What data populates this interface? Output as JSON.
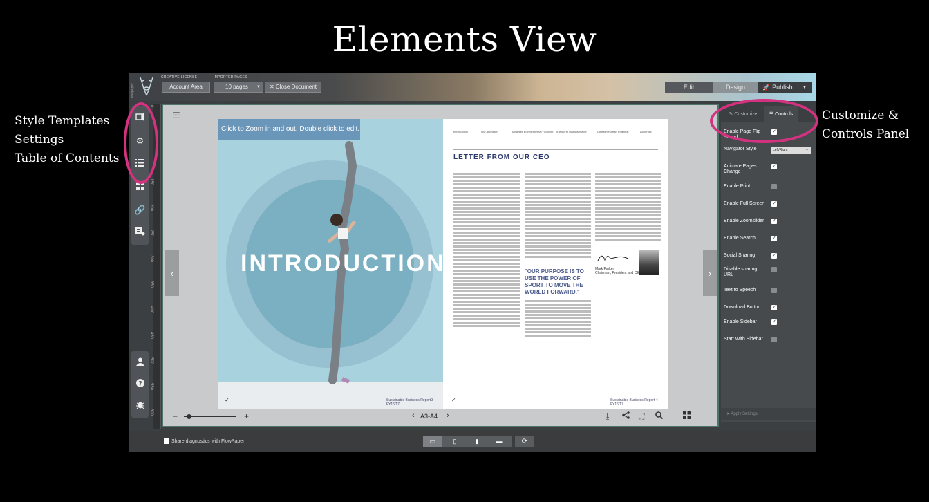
{
  "title": "Elements View",
  "annotations": {
    "left": [
      "Style Templates",
      "Settings",
      "Table of Contents"
    ],
    "right": [
      "Customize &",
      "Controls Panel"
    ]
  },
  "topbar": {
    "brand_vertical": "flowpaper",
    "creative_license_label": "CREATIVE LICENSE",
    "imported_pages_label": "IMPORTED PAGES",
    "account_area": "Account Area",
    "pages_select": "10 pages",
    "close_document": "Close Document",
    "edit": "Edit",
    "design": "Design",
    "publish": "Publish"
  },
  "ruler_ticks": [
    "0",
    "150",
    "200",
    "250",
    "300",
    "350",
    "400",
    "450",
    "500",
    "550",
    "600"
  ],
  "viewer": {
    "zoom_tip": "Click to Zoom in and out. Double click to edit.",
    "intro_title": "INTRODUCTION",
    "left_footer": "Sustainable Business Report FY16/17",
    "left_page_num": "3",
    "right_footer": "Sustainable Business Report FY16/17",
    "right_page_num": "4",
    "nav_items": [
      "Introduction",
      "Our Approach",
      "Minimize Environmental Footprint",
      "Transform Manufacturing",
      "Unleash Human Potential",
      "Appendix"
    ],
    "heading": "LETTER FROM OUR CEO",
    "quote": "\"OUR PURPOSE IS TO USE THE POWER OF SPORT TO MOVE THE WORLD FORWARD.\"",
    "signer_name": "Mark Parker",
    "signer_title": "Chairman, President and CEO",
    "page_indicator": "A3-A4",
    "zoom_minus": "−",
    "zoom_plus": "+"
  },
  "panel": {
    "tab_customize": "Customize",
    "tab_controls": "Controls",
    "rows": [
      {
        "label": "Enable Page Flip Sound",
        "checked": true
      },
      {
        "label": "Navigator Style",
        "select": "Left/Right"
      },
      {
        "label": "Animate Pages Change",
        "checked": true
      },
      {
        "label": "Enable Print",
        "checked": false
      },
      {
        "label": "Enable Full Screen",
        "checked": true
      },
      {
        "label": "Enable Zoomslider",
        "checked": true
      },
      {
        "label": "Enable Search",
        "checked": true
      },
      {
        "label": "Social Sharing",
        "checked": true
      },
      {
        "label": "Disable sharing URL",
        "checked": false
      },
      {
        "label": "Text to Speech",
        "checked": false
      },
      {
        "label": "Download Button",
        "checked": true
      },
      {
        "label": "Enable Sidebar",
        "checked": true
      },
      {
        "label": "Start With Sidebar",
        "checked": false
      }
    ],
    "apply_settings": "Apply Settings"
  },
  "bottom": {
    "diagnostics": "Share diagnostics with FlowPaper"
  },
  "colors": {
    "highlight": "#d2327f",
    "viewer_border": "#4f7469",
    "heading_navy": "#2b3a6b"
  }
}
